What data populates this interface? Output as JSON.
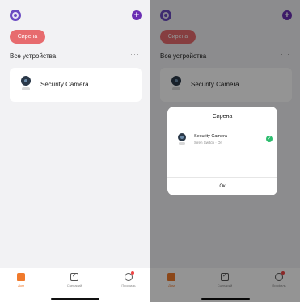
{
  "header": {
    "avatar_icon": "avatar-icon",
    "add_icon": "plus-icon",
    "add_symbol": "+"
  },
  "scene_pill": {
    "label": "Сирена"
  },
  "devices_section": {
    "title": "Все устройства",
    "more": "···"
  },
  "device": {
    "name": "Security Camera",
    "icon": "camera-icon"
  },
  "tabbar": {
    "tabs": [
      {
        "label": "Дом",
        "icon": "home-icon",
        "active": true
      },
      {
        "label": "Сценарий",
        "icon": "scenario-icon",
        "active": false
      },
      {
        "label": "Профиль",
        "icon": "profile-icon",
        "active": false
      }
    ]
  },
  "dialog": {
    "title": "Сирена",
    "device_name": "Security Camera",
    "device_status": "Siren Switch · On",
    "check_icon": "checkmark-icon",
    "check_symbol": "✓",
    "ok_label": "Ок"
  },
  "colors": {
    "accent_purple": "#6b2fb3",
    "pill_red": "#e76b6e",
    "tab_active": "#f07a2c",
    "check_green": "#2dbd6e"
  }
}
